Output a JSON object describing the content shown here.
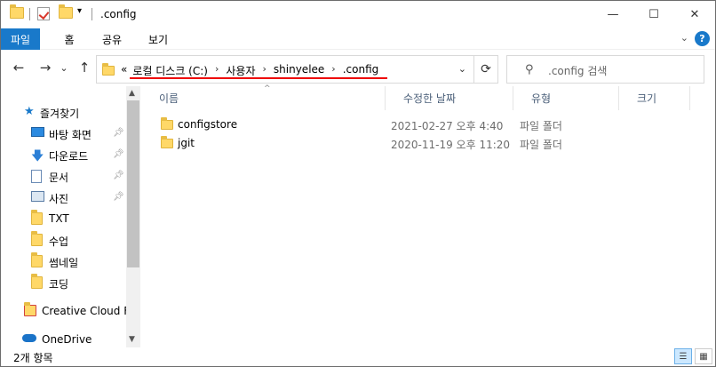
{
  "titlebar": {
    "title": ".config",
    "minimize": "—",
    "maximize": "☐",
    "close": "✕"
  },
  "ribbon": {
    "tabs": [
      {
        "label": "파일"
      },
      {
        "label": "홈"
      },
      {
        "label": "공유"
      },
      {
        "label": "보기"
      }
    ],
    "help": "?"
  },
  "nav": {
    "back": "←",
    "forward": "→",
    "recent": "⌄",
    "up": "↑"
  },
  "address": {
    "overflow": "«",
    "crumbs": [
      "로컬 디스크 (C:)",
      "사용자",
      "shinyelee",
      ".config"
    ],
    "separator": "›"
  },
  "search": {
    "placeholder": ".config 검색"
  },
  "sidebar": {
    "items": [
      {
        "label": "즐겨찾기",
        "icon": "star-icon"
      },
      {
        "label": "바탕 화면",
        "icon": "desktop-icon",
        "pinned": true
      },
      {
        "label": "다운로드",
        "icon": "download-icon",
        "pinned": true
      },
      {
        "label": "문서",
        "icon": "document-icon",
        "pinned": true
      },
      {
        "label": "사진",
        "icon": "pictures-icon",
        "pinned": true
      },
      {
        "label": "TXT",
        "icon": "folder-icon"
      },
      {
        "label": "수업",
        "icon": "folder-icon"
      },
      {
        "label": "썸네일",
        "icon": "folder-icon"
      },
      {
        "label": "코딩",
        "icon": "folder-icon"
      },
      {
        "label": "Creative Cloud Fil",
        "icon": "creative-cloud-icon"
      },
      {
        "label": "OneDrive",
        "icon": "cloud-icon"
      }
    ]
  },
  "columns": {
    "name": "이름",
    "modified": "수정한 날짜",
    "type": "유형",
    "size": "크기"
  },
  "files": [
    {
      "name": "configstore",
      "modified": "2021-02-27 오후 4:40",
      "type": "파일 폴더"
    },
    {
      "name": "jgit",
      "modified": "2020-11-19 오후 11:20",
      "type": "파일 폴더"
    }
  ],
  "status": {
    "count": "2개 항목"
  },
  "colors": {
    "accent": "#1979ca",
    "folder": "#ffd868",
    "underline": "#ee0000"
  }
}
